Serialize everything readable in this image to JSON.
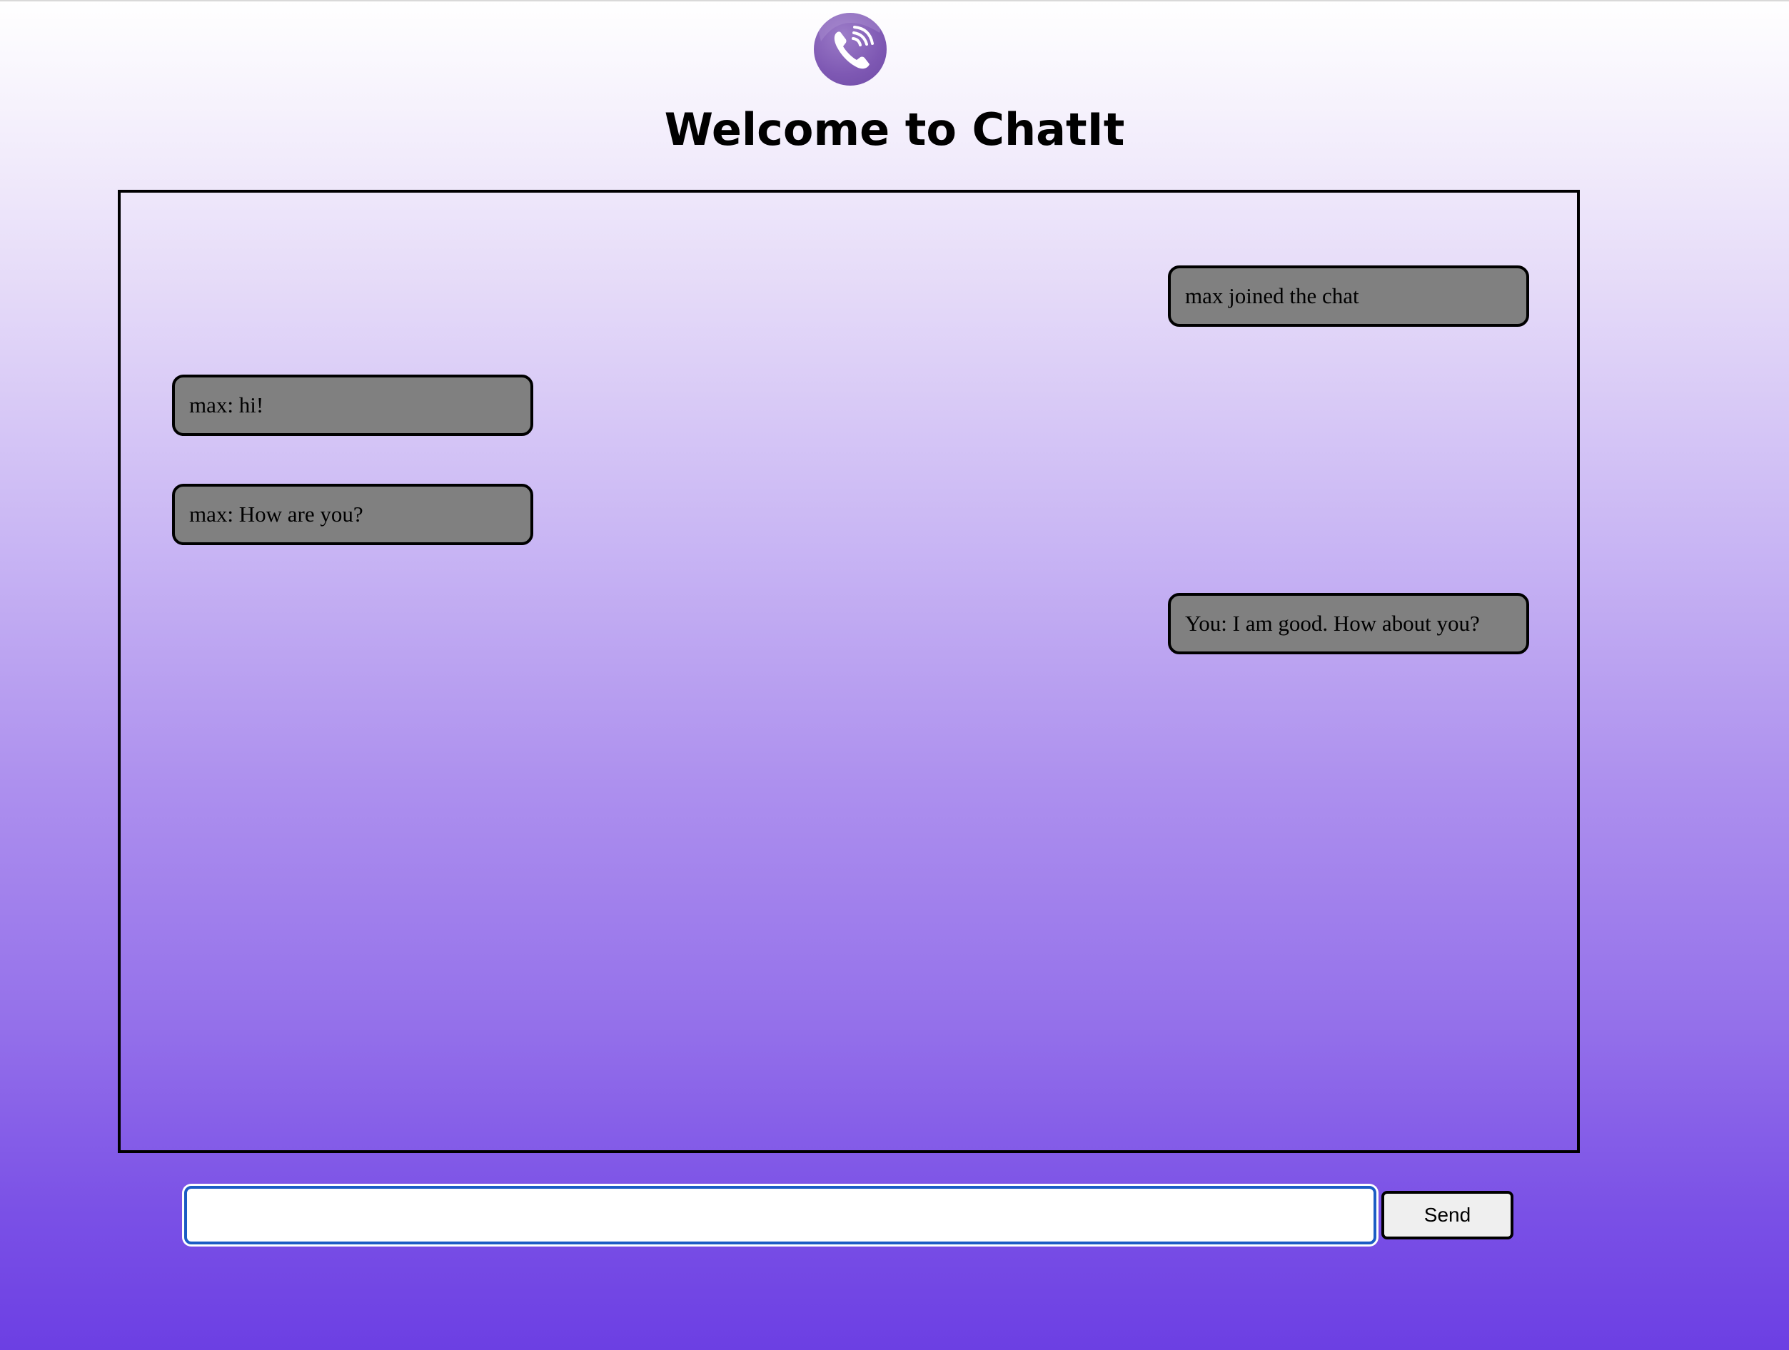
{
  "header": {
    "logo_icon": "phone-signal-icon",
    "title": "Welcome to ChatIt"
  },
  "chat": {
    "messages": [
      {
        "text": "max joined the chat",
        "side": "right"
      },
      {
        "text": "max: hi!",
        "side": "left"
      },
      {
        "text": "max: How are you?",
        "side": "left"
      },
      {
        "text": "You: I am good. How about you?",
        "side": "right"
      }
    ]
  },
  "composer": {
    "input_value": "",
    "send_label": "Send"
  },
  "colors": {
    "bubble": "#808080",
    "logo": "#7e58b3",
    "input_focus": "#1c5cc4"
  }
}
